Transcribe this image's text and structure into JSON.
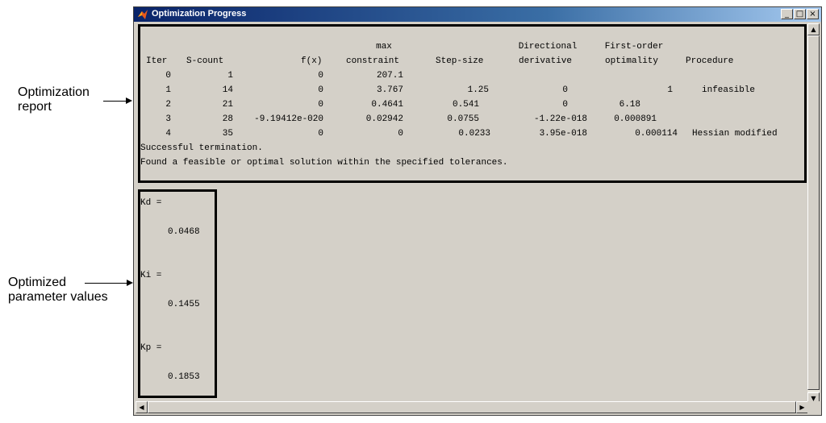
{
  "annotations": {
    "report_label": [
      "Optimization",
      "report"
    ],
    "params_label": [
      "Optimized",
      "parameter values"
    ]
  },
  "window": {
    "title": "Optimization Progress",
    "controls": {
      "minimize": "_",
      "maximize": "□",
      "close": "×"
    },
    "icon": "matlab-logo-icon"
  },
  "report": {
    "header_top": {
      "max": "max",
      "directional": "Directional",
      "first_order": "First-order"
    },
    "columns": [
      "Iter",
      "S-count",
      "f(x)",
      "constraint",
      "Step-size",
      "derivative",
      "optimality",
      "Procedure"
    ],
    "rows": [
      [
        "0",
        "1",
        "0",
        "207.1",
        "",
        "",
        "",
        ""
      ],
      [
        "1",
        "14",
        "0",
        "3.767",
        "1.25",
        "0",
        "1",
        "infeasible"
      ],
      [
        "2",
        "21",
        "0",
        "0.4641",
        "0.541",
        "0",
        "6.18",
        ""
      ],
      [
        "3",
        "28",
        "-9.19412e-020",
        "0.02942",
        "0.0755",
        "-1.22e-018",
        "0.000891",
        ""
      ],
      [
        "4",
        "35",
        "0",
        "0",
        "0.0233",
        "3.95e-018",
        "0.000114",
        "Hessian modified"
      ]
    ],
    "termination": "Successful termination.",
    "message": "Found a feasible or optimal solution within the specified tolerances."
  },
  "params": [
    {
      "label": "Kd =",
      "value": "0.0468"
    },
    {
      "label": "Ki =",
      "value": "0.1455"
    },
    {
      "label": "Kp =",
      "value": "0.1853"
    }
  ],
  "scrollbars": {
    "up": "▲",
    "down": "▼",
    "left": "◀",
    "right": "▶"
  }
}
